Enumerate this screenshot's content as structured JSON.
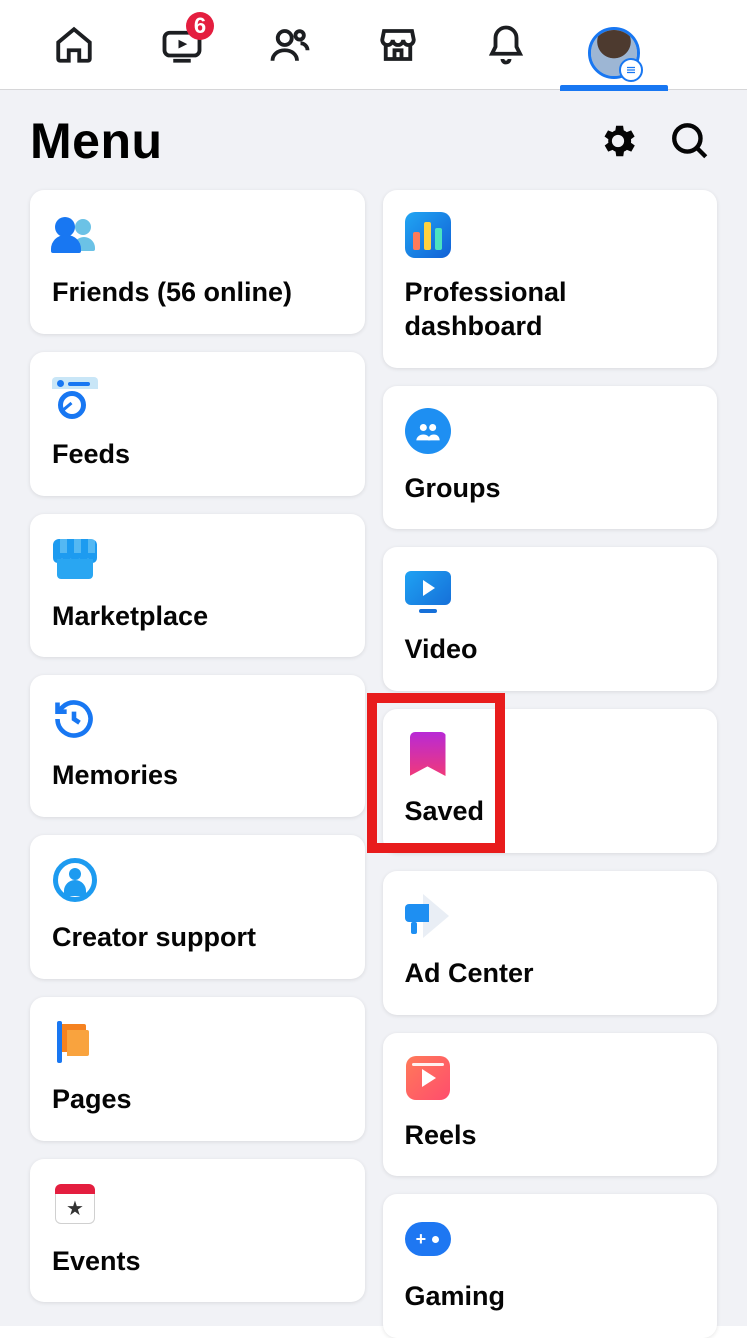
{
  "topnav": {
    "notifications_count": "6"
  },
  "header": {
    "title": "Menu"
  },
  "left_column": [
    {
      "id": "friends",
      "label": "Friends (56 online)"
    },
    {
      "id": "feeds",
      "label": "Feeds"
    },
    {
      "id": "marketplace",
      "label": "Marketplace"
    },
    {
      "id": "memories",
      "label": "Memories"
    },
    {
      "id": "creator-support",
      "label": "Creator support"
    },
    {
      "id": "pages",
      "label": "Pages"
    },
    {
      "id": "events",
      "label": "Events"
    }
  ],
  "right_column": [
    {
      "id": "pro-dashboard",
      "label": "Professional dashboard"
    },
    {
      "id": "groups",
      "label": "Groups"
    },
    {
      "id": "video",
      "label": "Video"
    },
    {
      "id": "saved",
      "label": "Saved",
      "highlighted": true
    },
    {
      "id": "ad-center",
      "label": "Ad Center"
    },
    {
      "id": "reels",
      "label": "Reels"
    },
    {
      "id": "gaming",
      "label": "Gaming"
    }
  ]
}
